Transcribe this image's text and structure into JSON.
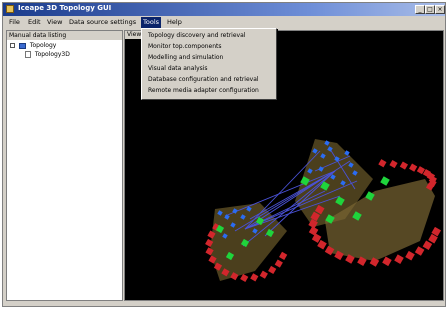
{
  "window": {
    "title": "Iceape 3D Topology GUI"
  },
  "menubar": {
    "items": [
      "File",
      "Edit",
      "View",
      "Data source settings",
      "Tools",
      "Help"
    ],
    "active_index": 4
  },
  "tools_menu": {
    "items": [
      "Topology discovery and retrieval",
      "Monitor top.components",
      "Modelling and simulation",
      "Visual data analysis",
      "Database configuration and retrieval",
      "Remote media adapter configuration"
    ]
  },
  "left_panel": {
    "header": "Manual data listing",
    "tree": [
      {
        "label": "Topology",
        "level": 0,
        "icon": "folder-icon"
      },
      {
        "label": "Topology3D",
        "level": 1,
        "icon": "file-icon"
      }
    ]
  },
  "right_panel": {
    "header": "View"
  },
  "colors": {
    "title_bar": "#1a3b8c",
    "menu_highlight": "#0a246a",
    "canvas_bg": "#000000",
    "node_red": "#d2262c",
    "node_green": "#1fd43c",
    "node_blue": "#2b6cf2",
    "link": "#4a52d8"
  }
}
